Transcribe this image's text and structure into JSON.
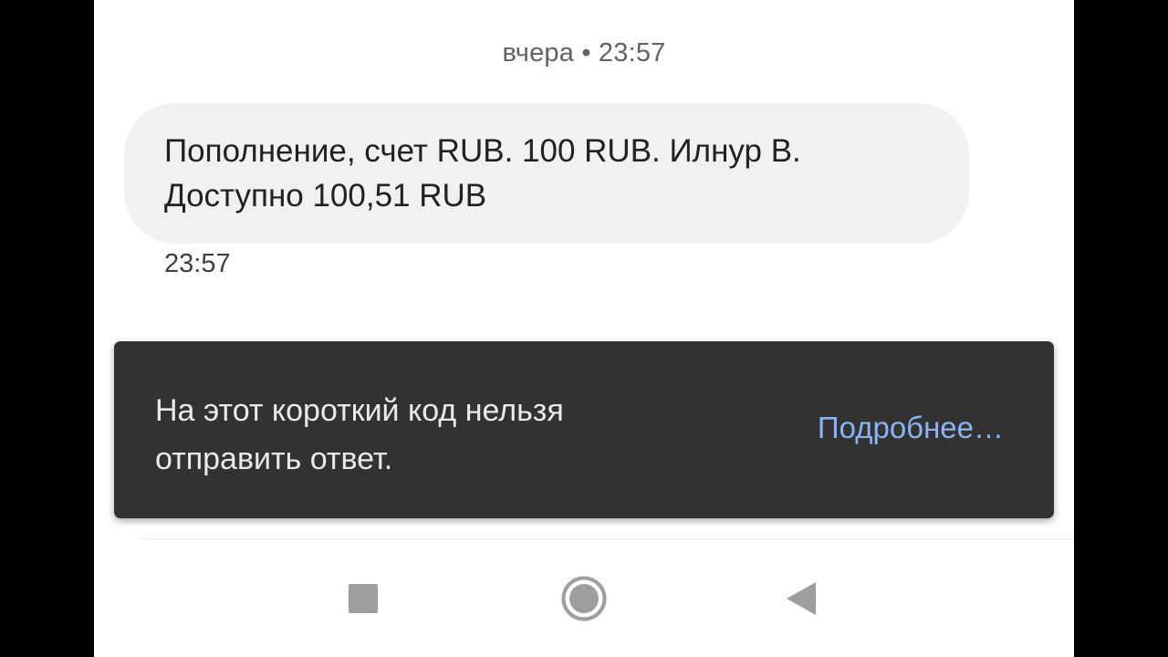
{
  "conversation": {
    "date_header": "вчера • 23:57",
    "message": {
      "text": "Пополнение, счет RUB. 100 RUB. Илнур В. Доступно 100,51 RUB",
      "time": "23:57"
    }
  },
  "snackbar": {
    "text": "На этот короткий код нельзя отправить ответ.",
    "action_label": "Подробнее…"
  },
  "nav_bar": {
    "buttons": [
      {
        "icon": "square-recents-icon"
      },
      {
        "icon": "circle-home-icon"
      },
      {
        "icon": "triangle-back-icon"
      }
    ]
  },
  "colors": {
    "bubble_bg": "#f1f1f1",
    "snackbar_bg": "#323232",
    "snackbar_action": "#8ab4f8",
    "nav_icon": "#9e9e9e"
  }
}
